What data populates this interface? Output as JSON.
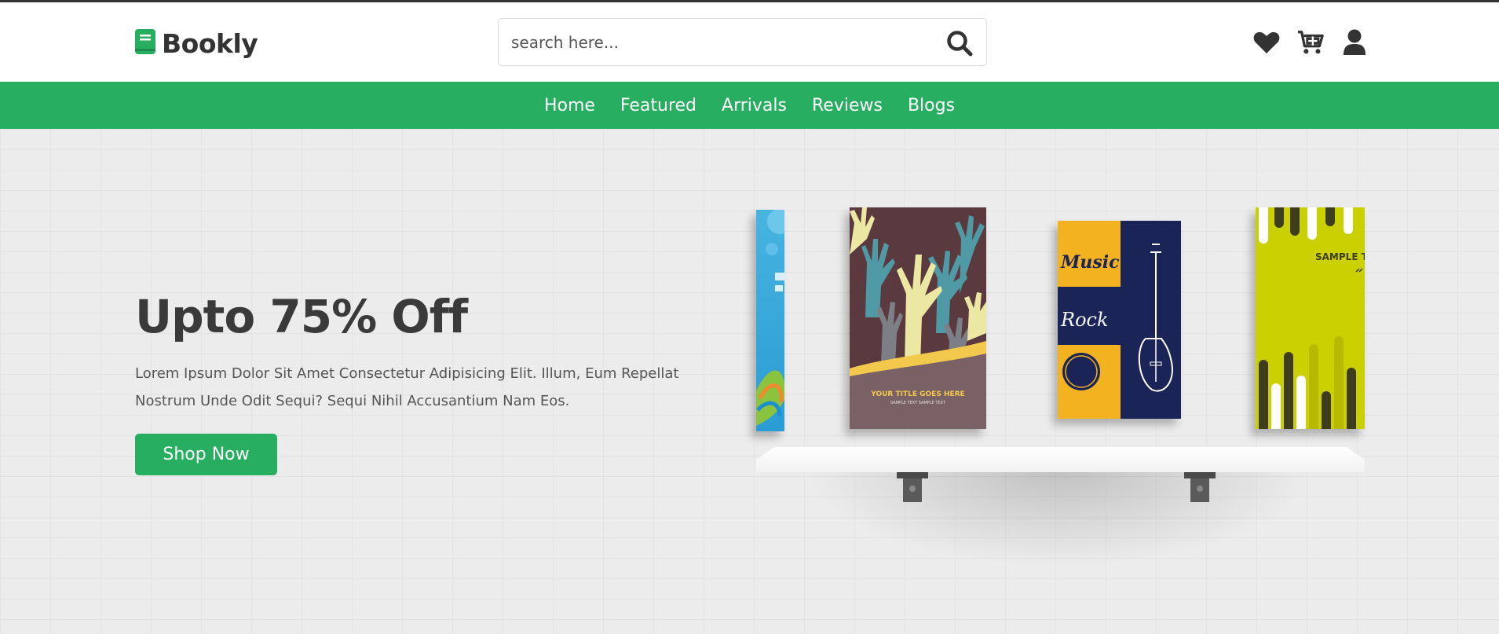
{
  "header": {
    "logo_text": "Bookly",
    "search_placeholder": "search here..."
  },
  "nav": {
    "items": [
      "Home",
      "Featured",
      "Arrivals",
      "Reviews",
      "Blogs"
    ]
  },
  "hero": {
    "title": "Upto 75% Off",
    "description": "Lorem Ipsum Dolor Sit Amet Consectetur Adipisicing Elit. Illum, Eum Repellat Nostrum Unde Odit Sequi? Sequi Nihil Accusantium Nam Eos.",
    "button_label": "Shop Now"
  },
  "books": {
    "book2_caption": "YOUR TITLE GOES HERE",
    "book2_sub": "SAMPLE TEXT SAMPLE TEXT",
    "book3_title_a": "Music",
    "book3_title_b": "Rock",
    "book4_caption": "SAMPLE T"
  },
  "colors": {
    "brand": "#27ae60",
    "text_dark": "#333333"
  },
  "icons": [
    "book-icon",
    "search-icon",
    "heart-icon",
    "cart-icon",
    "user-icon"
  ]
}
